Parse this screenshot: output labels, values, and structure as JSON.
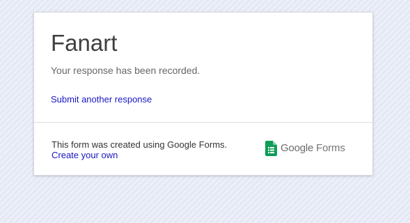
{
  "form": {
    "title": "Fanart",
    "confirmation_message": "Your response has been recorded.",
    "submit_another_label": "Submit another response"
  },
  "footer": {
    "created_text": "This form was created using Google Forms.",
    "create_own_label": "Create your own",
    "brand_google": "Google",
    "brand_forms": "Forms",
    "brand_icon": "google-forms-icon"
  },
  "colors": {
    "link": "#1717c2",
    "forms_green": "#0f9d58",
    "background": "#e6eaf5"
  }
}
